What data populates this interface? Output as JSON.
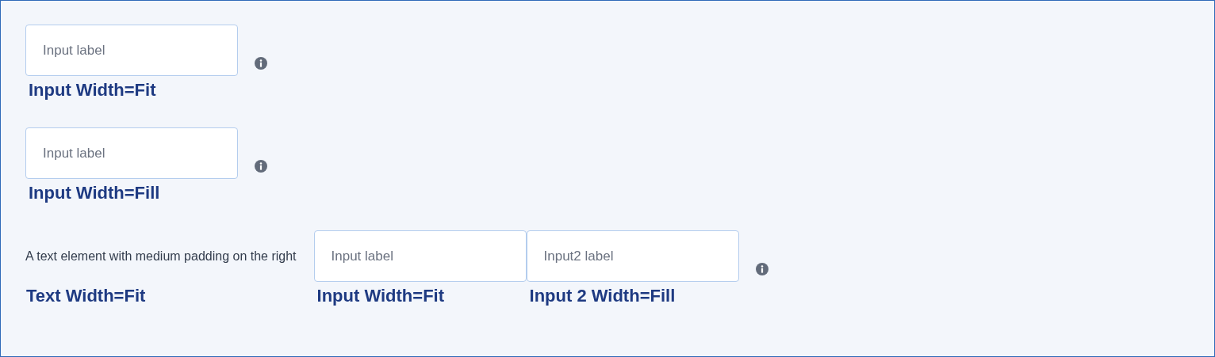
{
  "rows": [
    {
      "cells": [
        {
          "kind": "input",
          "placeholder": "Input label",
          "caption": "Input Width=Fit"
        }
      ]
    },
    {
      "cells": [
        {
          "kind": "input",
          "placeholder": "Input label",
          "caption": "Input Width=Fill"
        }
      ]
    },
    {
      "cells": [
        {
          "kind": "text",
          "text": "A text element with medium padding on the right",
          "caption": "Text Width=Fit"
        },
        {
          "kind": "input",
          "placeholder": "Input label",
          "caption": "Input Width=Fit"
        },
        {
          "kind": "input",
          "placeholder": "Input2 label",
          "caption": "Input 2 Width=Fill"
        }
      ]
    }
  ]
}
